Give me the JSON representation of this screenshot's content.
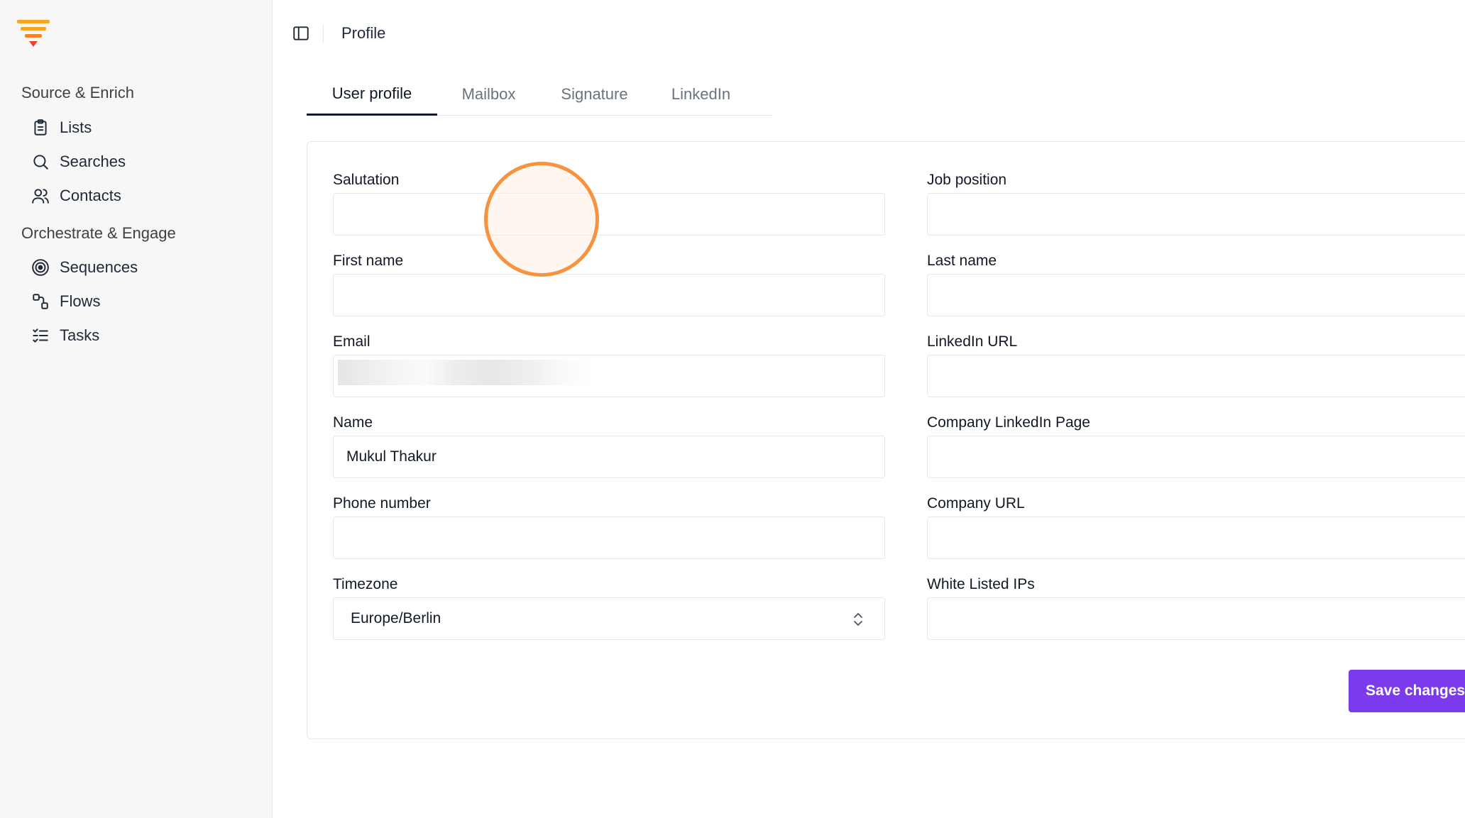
{
  "sidebar": {
    "logo": "brand-logo",
    "sections": [
      {
        "title": "Source & Enrich",
        "items": [
          {
            "label": "Lists",
            "icon": "clipboard-icon"
          },
          {
            "label": "Searches",
            "icon": "search-icon"
          },
          {
            "label": "Contacts",
            "icon": "users-icon"
          }
        ]
      },
      {
        "title": "Orchestrate & Engage",
        "items": [
          {
            "label": "Sequences",
            "icon": "target-icon"
          },
          {
            "label": "Flows",
            "icon": "flows-icon"
          },
          {
            "label": "Tasks",
            "icon": "tasks-icon"
          }
        ]
      }
    ]
  },
  "header": {
    "title": "Profile"
  },
  "tabs": [
    {
      "label": "User profile",
      "active": true
    },
    {
      "label": "Mailbox",
      "active": false
    },
    {
      "label": "Signature",
      "active": false
    },
    {
      "label": "LinkedIn",
      "active": false
    }
  ],
  "form": {
    "left": [
      {
        "label": "Salutation",
        "value": ""
      },
      {
        "label": "First name",
        "value": ""
      },
      {
        "label": "Email",
        "value": ""
      },
      {
        "label": "Name",
        "value": "Mukul Thakur"
      },
      {
        "label": "Phone number",
        "value": ""
      },
      {
        "label": "Timezone",
        "value": "Europe/Berlin"
      }
    ],
    "right": [
      {
        "label": "Job position",
        "value": ""
      },
      {
        "label": "Last name",
        "value": ""
      },
      {
        "label": "LinkedIn URL",
        "value": ""
      },
      {
        "label": "Company LinkedIn Page",
        "value": ""
      },
      {
        "label": "Company URL",
        "value": ""
      },
      {
        "label": "White Listed IPs",
        "value": ""
      }
    ],
    "save_label": "Save changes"
  },
  "colors": {
    "accent": "#7c3aed",
    "logo_orange": "#f5a623",
    "logo_red": "#e8452c",
    "click_ring": "#f59340"
  }
}
